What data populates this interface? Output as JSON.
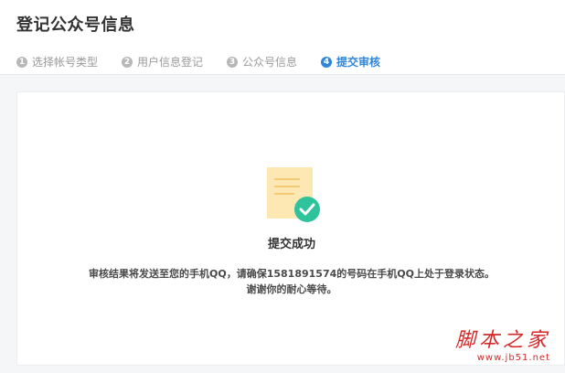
{
  "header": {
    "title": "登记公众号信息",
    "steps": [
      {
        "num": "1",
        "label": "选择帐号类型"
      },
      {
        "num": "2",
        "label": "用户信息登记"
      },
      {
        "num": "3",
        "label": "公众号信息"
      },
      {
        "num": "4",
        "label": "提交审核"
      }
    ],
    "active_step": 4
  },
  "result": {
    "icon": "success-document-icon",
    "title": "提交成功",
    "line1": "审核结果将发送至您的手机QQ，请确保1581891574的号码在手机QQ上处于登录状态。",
    "line2": "谢谢你的耐心等待。"
  },
  "watermark": {
    "main": "脚本之家",
    "url": "www.jb51.net"
  },
  "colors": {
    "accent": "#2f86d9",
    "success": "#2ec39a",
    "doc": "#fde8b3"
  }
}
